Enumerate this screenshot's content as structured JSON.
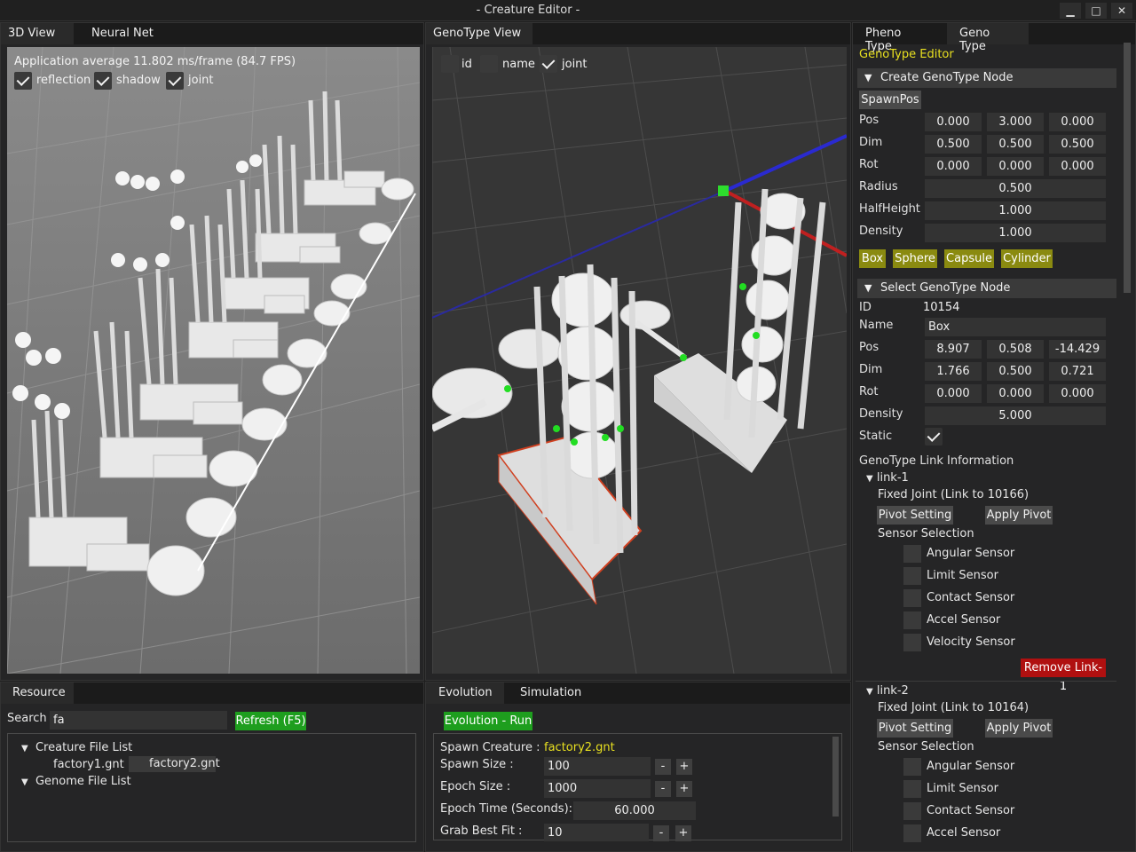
{
  "window": {
    "title": "- Creature Editor -"
  },
  "left_tabs": [
    "3D View",
    "Neural Net"
  ],
  "view3d": {
    "stats": "Application average 11.802 ms/frame (84.7 FPS)",
    "options": [
      {
        "label": "reflection",
        "checked": true
      },
      {
        "label": "shadow",
        "checked": true
      },
      {
        "label": "joint",
        "checked": true
      }
    ]
  },
  "genotype_view": {
    "tab": "GenoType View",
    "options": [
      {
        "label": "id",
        "checked": false
      },
      {
        "label": "name",
        "checked": false
      },
      {
        "label": "joint",
        "checked": true
      }
    ]
  },
  "right_tabs": [
    "Pheno Type",
    "Geno Type"
  ],
  "editor": {
    "title": "GenoType Editor",
    "create": {
      "header": "Create GenoType Node",
      "spawn_label": "SpawnPos",
      "pos_label": "Pos",
      "pos": [
        "0.000",
        "3.000",
        "0.000"
      ],
      "dim_label": "Dim",
      "dim": [
        "0.500",
        "0.500",
        "0.500"
      ],
      "rot_label": "Rot",
      "rot": [
        "0.000",
        "0.000",
        "0.000"
      ],
      "radius_label": "Radius",
      "radius": "0.500",
      "halfheight_label": "HalfHeight",
      "halfheight": "1.000",
      "density_label": "Density",
      "density": "1.000",
      "shape_buttons": [
        "Box",
        "Sphere",
        "Capsule",
        "Cylinder"
      ]
    },
    "select": {
      "header": "Select GenoType Node",
      "id_label": "ID",
      "id": "10154",
      "name_label": "Name",
      "name": "Box",
      "pos_label": "Pos",
      "pos": [
        "8.907",
        "0.508",
        "-14.429"
      ],
      "dim_label": "Dim",
      "dim": [
        "1.766",
        "0.500",
        "0.721"
      ],
      "rot_label": "Rot",
      "rot": [
        "0.000",
        "0.000",
        "0.000"
      ],
      "density_label": "Density",
      "density": "5.000",
      "static_label": "Static",
      "static": true
    },
    "link_info_title": "GenoType Link Information",
    "links": [
      {
        "name": "link-1",
        "joint": "Fixed Joint (Link to 10166)",
        "pivot_setting": "Pivot Setting",
        "apply_pivot": "Apply Pivot",
        "sensor_title": "Sensor Selection",
        "sensors": [
          "Angular Sensor",
          "Limit Sensor",
          "Contact Sensor",
          "Accel Sensor",
          "Velocity Sensor"
        ],
        "remove": "Remove Link-1"
      },
      {
        "name": "link-2",
        "joint": "Fixed Joint (Link to 10164)",
        "pivot_setting": "Pivot Setting",
        "apply_pivot": "Apply Pivot",
        "sensor_title": "Sensor Selection",
        "sensors": [
          "Angular Sensor",
          "Limit Sensor",
          "Contact Sensor",
          "Accel Sensor"
        ]
      }
    ]
  },
  "resource": {
    "tab": "Resource",
    "search_label": "Search",
    "search_value": "fa",
    "refresh": "Refresh (F5)",
    "creature_list_title": "Creature File List",
    "creature_files": [
      "factory1.gnt",
      "factory2.gnt"
    ],
    "genome_list_title": "Genome File List"
  },
  "evolution": {
    "tabs": [
      "Evolution",
      "Simulation"
    ],
    "run": "Evolution - Run",
    "spawn_creature_label": "Spawn Creature :",
    "spawn_creature": "factory2.gnt",
    "spawn_size_label": "Spawn Size :",
    "spawn_size": "100",
    "epoch_size_label": "Epoch Size :",
    "epoch_size": "1000",
    "epoch_time_label": "Epoch Time (Seconds):",
    "epoch_time": "60.000",
    "grab_label": "Grab Best Fit :",
    "grab": "10",
    "minus": "-",
    "plus": "+"
  },
  "colors": {
    "accent_yellow": "#e8e020",
    "button_green": "#1e9e1e",
    "button_yellow": "#8a8a10",
    "remove_red": "#b01010"
  }
}
